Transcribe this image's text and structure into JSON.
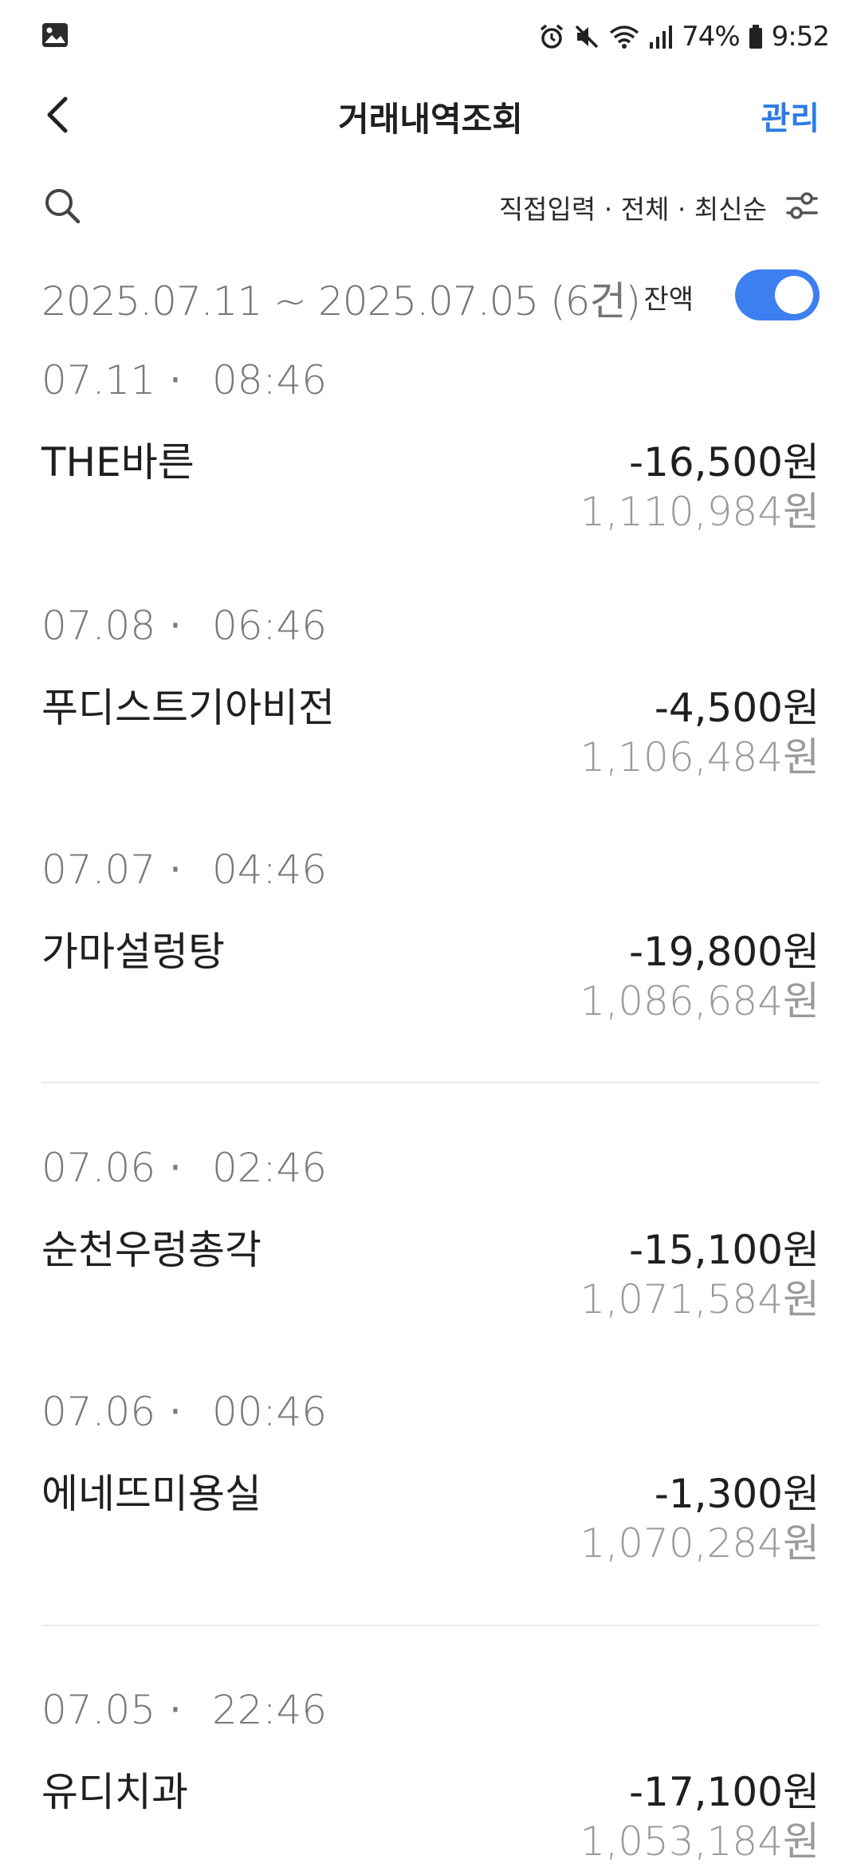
{
  "status_bar": {
    "battery": "74%",
    "time": "9:52",
    "icons": [
      "gallery-icon",
      "alarm-icon",
      "mute-icon",
      "wifi-icon",
      "signal-icon",
      "battery-icon"
    ]
  },
  "header": {
    "title": "거래내역조회",
    "manage_label": "관리"
  },
  "filter": {
    "summary": "직접입력 · 전체 · 최신순"
  },
  "range": {
    "text": "2025.07.11 ~ 2025.07.05 (6건)",
    "balance_label": "잔액",
    "balance_toggle_on": true
  },
  "colors": {
    "accent": "#2c7be5",
    "toggle": "#3d7ff0",
    "muted": "#9a9a9a"
  },
  "transactions": [
    {
      "date": "07.11",
      "separator": "·",
      "time": "08:46",
      "name": "THE바른",
      "amount": "-16,500원",
      "balance": "1,110,984원"
    },
    {
      "date": "07.08",
      "separator": "·",
      "time": "06:46",
      "name": "푸디스트기아비전",
      "amount": "-4,500원",
      "balance": "1,106,484원"
    },
    {
      "date": "07.07",
      "separator": "·",
      "time": "04:46",
      "name": "가마설렁탕",
      "amount": "-19,800원",
      "balance": "1,086,684원"
    },
    {
      "date": "07.06",
      "separator": "·",
      "time": "02:46",
      "name": "순천우렁총각",
      "amount": "-15,100원",
      "balance": "1,071,584원"
    },
    {
      "date": "07.06",
      "separator": "·",
      "time": "00:46",
      "name": "에네뜨미용실",
      "amount": "-1,300원",
      "balance": "1,070,284원"
    },
    {
      "date": "07.05",
      "separator": "·",
      "time": "22:46",
      "name": "유디치과",
      "amount": "-17,100원",
      "balance": "1,053,184원"
    }
  ]
}
